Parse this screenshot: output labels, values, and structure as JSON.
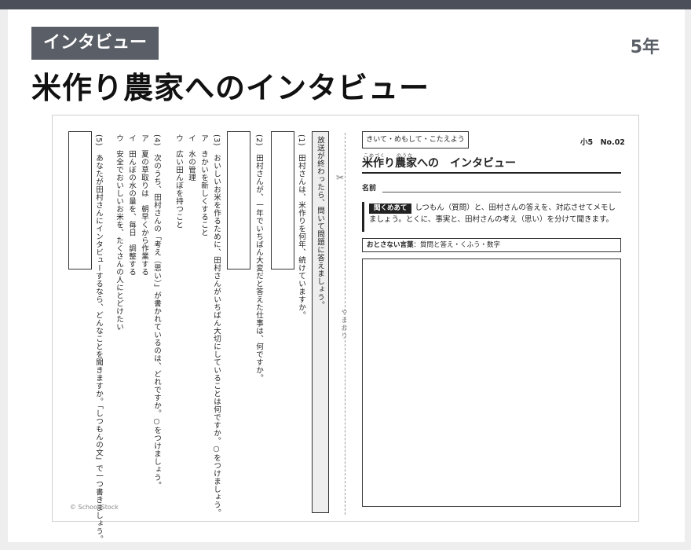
{
  "category": "インタビュー",
  "grade": "5年",
  "title": "米作り農家へのインタビュー",
  "worksheet": {
    "tag": "きいて・めもして・こたえよう",
    "code": "小5　No.02",
    "title_furigana": "こめづく　　のうか",
    "title": "米作り農家への　インタビュー",
    "name_label": "名前",
    "instruction_badge": "聞くめあて",
    "instruction_text": "しつもん（質問）と、田村さんの答えを、対応させてメモしましょう。とくに、事実と、田村さんの考え（思い）を分けて聞きます。",
    "keywords_label": "おとさない言葉",
    "keywords_text": "：質問と答え・くふう・数字",
    "fold_label": "やまおり",
    "note_text": "放送が終わったら、問いて問題に答えましょう。",
    "q1": "(1)　田村さんは、米作りを何年、続けていますか。",
    "q2": "(2)　田村さんが、一年でいちばん大変だと答えた仕事は、何ですか。",
    "q3": "(3)　おいしいお米を作るために、田村さんがいちばん大切にしていることは何ですか。○をつけましょう。",
    "q3_a": "ア　きかいを新しくすること",
    "q3_i": "イ　水の管理",
    "q3_u": "ウ　広い田んぼを持つこと",
    "q4": "(4)　次のうち、田村さんの「考え（思い）」が書かれているのは、どれですか。○をつけましょう。",
    "q4_a": "ア　夏の草取りは　朝早くから作業する",
    "q4_i": "イ　田んぼの水の量を、毎日　調整する",
    "q4_u": "ウ　安全でおいしいお米を、たくさんの人にとどけたい",
    "q5": "(5)　あなたが田村さんにインタビューするなら、どんなことを聞きますか。「しつもんの文」で一つ書きましょう。",
    "copyright": "© School Stock"
  }
}
